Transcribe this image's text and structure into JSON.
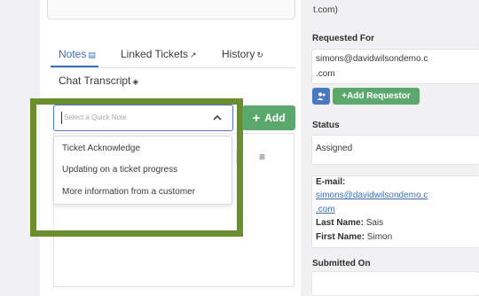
{
  "tabs": {
    "notes": "Notes",
    "linked_tickets": "Linked Tickets",
    "history": "History",
    "chat_transcript": "Chat Transcript"
  },
  "quick_note": {
    "placeholder": "Select a Quick Note",
    "options": [
      "Ticket Acknowledge",
      "Updating on a ticket progress",
      "More information from a customer"
    ]
  },
  "add_button": {
    "label": "Add"
  },
  "requester": {
    "prev_fragment": "t.com)",
    "label": "Requested For",
    "email_line1": "simons@davidwilsondemo.c",
    "email_line2": ".com",
    "add_requestor": "+Add Requestor"
  },
  "status": {
    "label": "Status",
    "value": "Assigned"
  },
  "contact": {
    "email_label": "E-mail:",
    "email_line1": "simons@davidwilsondemo.c",
    "email_line2": ".com",
    "last_name_label": "Last Name:",
    "last_name": "Sais",
    "first_name_label": "First Name:",
    "first_name": "Simon"
  },
  "submitted": {
    "label": "Submitted On"
  },
  "colors": {
    "highlight": "#6a8d2e",
    "accent_blue": "#3d6fb6",
    "button_green": "#5aa86b"
  }
}
